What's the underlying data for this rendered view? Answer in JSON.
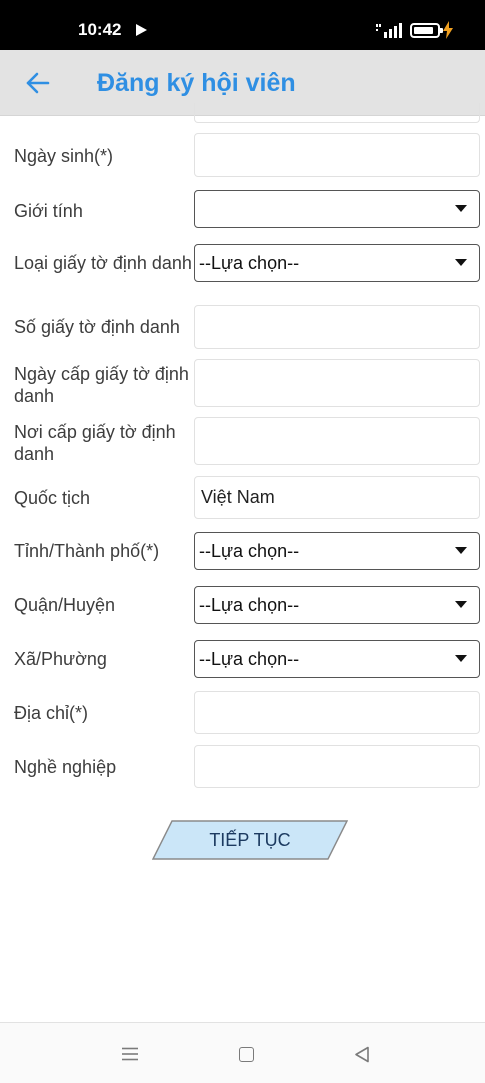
{
  "status_bar": {
    "time": "10:42",
    "icons": [
      "play-icon",
      "signal-icon",
      "battery-icon",
      "charge-icon"
    ]
  },
  "header": {
    "title": "Đăng ký hội viên",
    "back_icon": "arrow-left-icon"
  },
  "form": {
    "fields": [
      {
        "label": "Ngày sinh(*)",
        "type": "text",
        "value": ""
      },
      {
        "label": "Giới tính",
        "type": "select",
        "value": ""
      },
      {
        "label": "Loại giấy tờ định danh",
        "type": "select",
        "value": "--Lựa chọn--"
      },
      {
        "label": "Số giấy tờ định danh",
        "type": "text",
        "value": ""
      },
      {
        "label": "Ngày cấp giấy tờ định danh",
        "type": "text",
        "value": ""
      },
      {
        "label": "Nơi cấp giấy tờ định danh",
        "type": "text",
        "value": ""
      },
      {
        "label": "Quốc tịch",
        "type": "text",
        "value": "Việt Nam"
      },
      {
        "label": "Tỉnh/Thành phố(*)",
        "type": "select",
        "value": "--Lựa chọn--"
      },
      {
        "label": "Quận/Huyện",
        "type": "select",
        "value": "--Lựa chọn--"
      },
      {
        "label": "Xã/Phường",
        "type": "select",
        "value": "--Lựa chọn--"
      },
      {
        "label": "Địa chỉ(*)",
        "type": "text",
        "value": ""
      },
      {
        "label": "Nghề nghiệp",
        "type": "text",
        "value": ""
      }
    ],
    "continue_label": "TIẾP TỤC"
  },
  "nav_bar": {
    "icons": [
      "menu-icon",
      "home-square-icon",
      "back-triangle-icon"
    ]
  },
  "colors": {
    "accent": "#2f8fe3",
    "header_bg": "#e3e3e3",
    "button_fill": "#cbe6f8",
    "button_text": "#1c3a60"
  }
}
